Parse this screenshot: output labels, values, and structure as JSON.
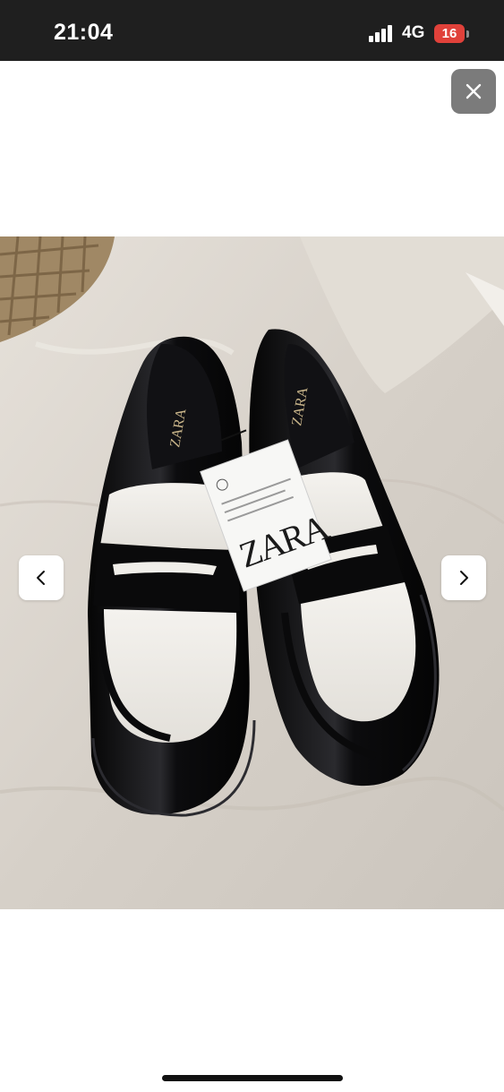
{
  "status_bar": {
    "time": "21:04",
    "network": "4G",
    "battery": "16",
    "battery_color": "#e0413a"
  },
  "viewer": {
    "close_icon": "close-icon",
    "prev_icon": "chevron-left-icon",
    "next_icon": "chevron-right-icon",
    "photo": {
      "subject": "black and white patent penny loafers on linen bedding",
      "tag_text": "ZARA",
      "insole_text": "ZARA"
    }
  }
}
